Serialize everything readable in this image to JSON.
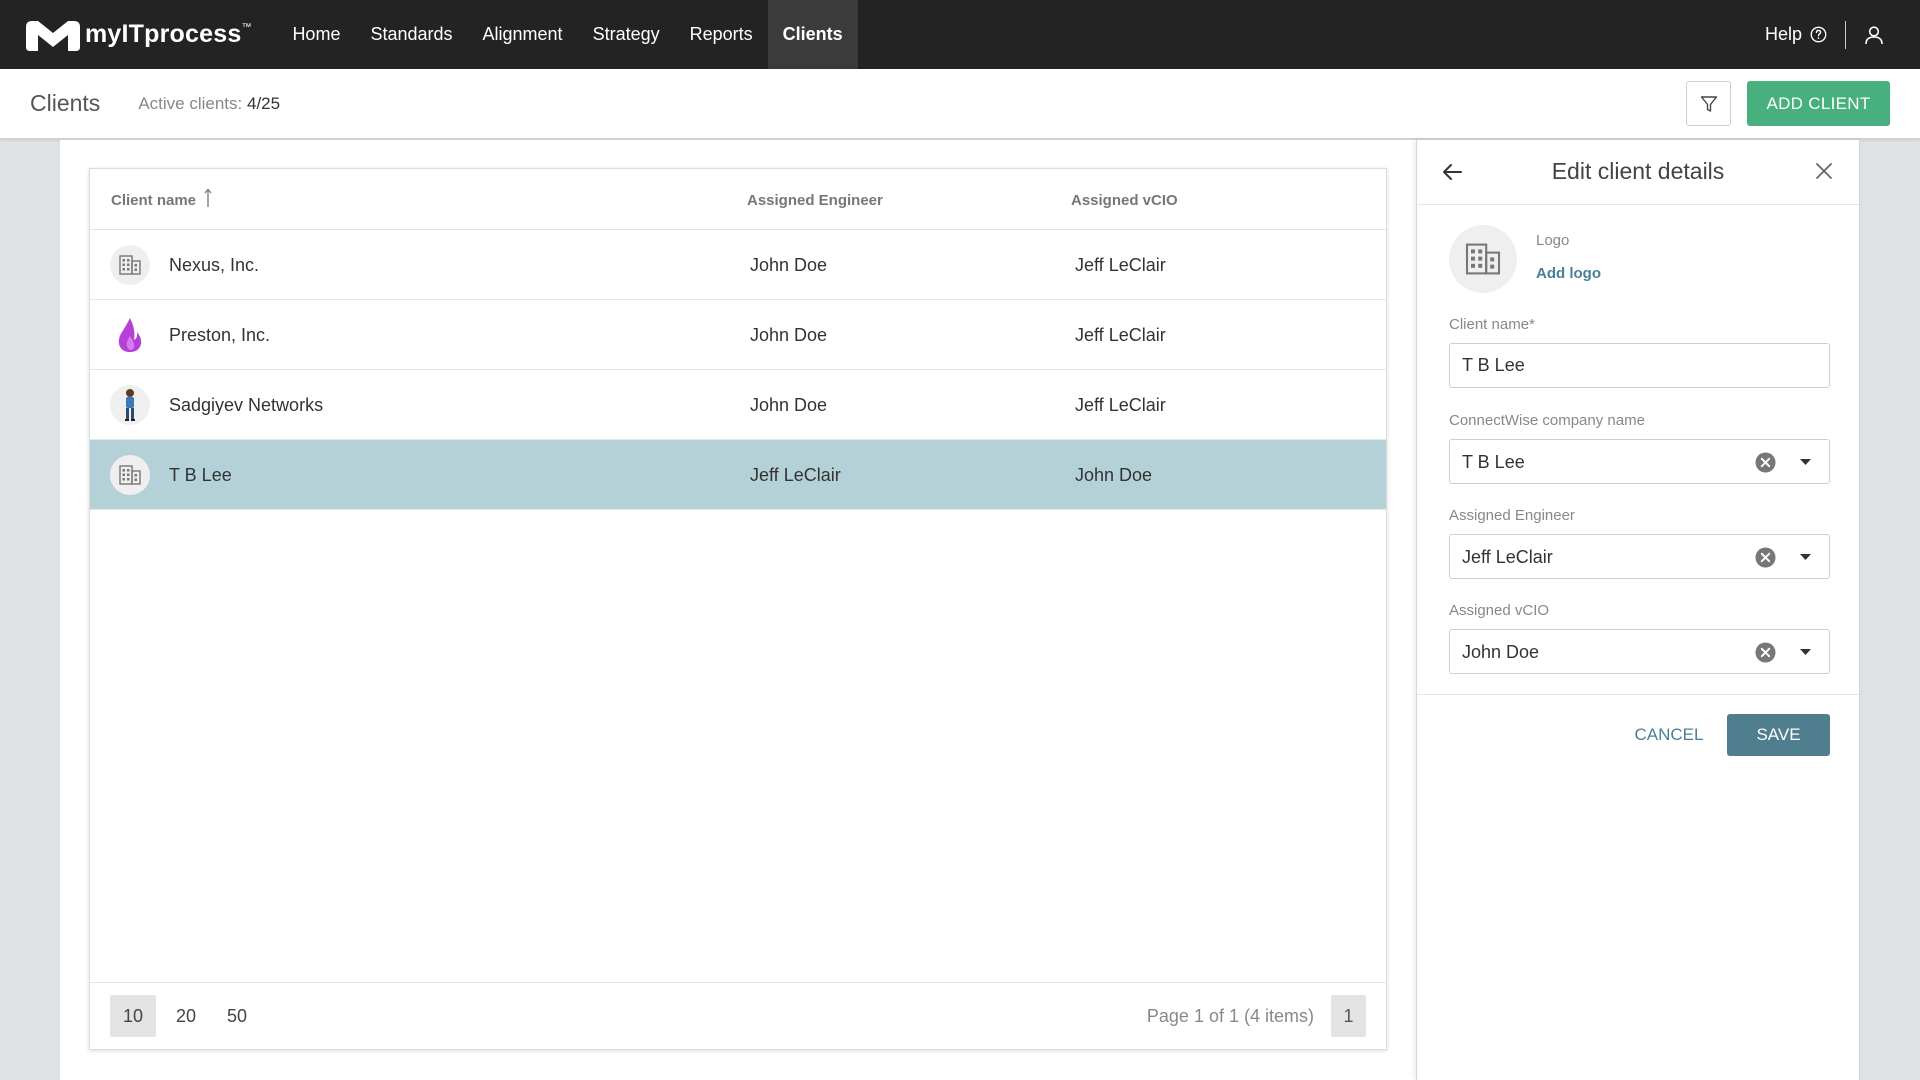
{
  "topnav": {
    "brand_name": "myITprocess",
    "brand_tm": "™",
    "items": [
      {
        "label": "Home",
        "active": false
      },
      {
        "label": "Standards",
        "active": false
      },
      {
        "label": "Alignment",
        "active": false
      },
      {
        "label": "Strategy",
        "active": false
      },
      {
        "label": "Reports",
        "active": false
      },
      {
        "label": "Clients",
        "active": true
      }
    ],
    "help_label": "Help",
    "icons": {
      "help": "question-circle-icon",
      "user": "user-icon"
    }
  },
  "subheader": {
    "title": "Clients",
    "active_clients_label": "Active clients:",
    "active_clients_value": "4/25",
    "add_client_label": "ADD CLIENT",
    "add_client_color": "#48b07f",
    "filter_icon": "filter-icon"
  },
  "table": {
    "columns": {
      "name": "Client name",
      "engineer": "Assigned Engineer",
      "vcio": "Assigned vCIO"
    },
    "sort_icon": "sort-ascending-icon",
    "rows": [
      {
        "name": "Nexus, Inc.",
        "engineer": "John Doe",
        "vcio": "Jeff LeClair",
        "logo": "building-icon",
        "selected": false
      },
      {
        "name": "Preston, Inc.",
        "engineer": "John Doe",
        "vcio": "Jeff LeClair",
        "logo": "flame-logo",
        "selected": false
      },
      {
        "name": "Sadgiyev Networks",
        "engineer": "John Doe",
        "vcio": "Jeff LeClair",
        "logo": "person-logo",
        "selected": false
      },
      {
        "name": "T B Lee",
        "engineer": "Jeff LeClair",
        "vcio": "John Doe",
        "logo": "building-icon",
        "selected": true
      }
    ],
    "selected_row_color": "#b4d1d7",
    "pagination": {
      "sizes": [
        "10",
        "20",
        "50"
      ],
      "active_size": "10",
      "info": "Page 1 of 1 (4 items)",
      "current_page": "1"
    }
  },
  "panel": {
    "title": "Edit client details",
    "logo_label": "Logo",
    "add_logo_label": "Add logo",
    "client_name_label": "Client name*",
    "client_name_value": "T B Lee",
    "connectwise_label": "ConnectWise company name",
    "connectwise_value": "T B Lee",
    "engineer_label": "Assigned Engineer",
    "engineer_value": "Jeff LeClair",
    "vcio_label": "Assigned vCIO",
    "vcio_value": "John Doe",
    "cancel_label": "CANCEL",
    "save_label": "SAVE",
    "save_color": "#4f7f8f"
  }
}
